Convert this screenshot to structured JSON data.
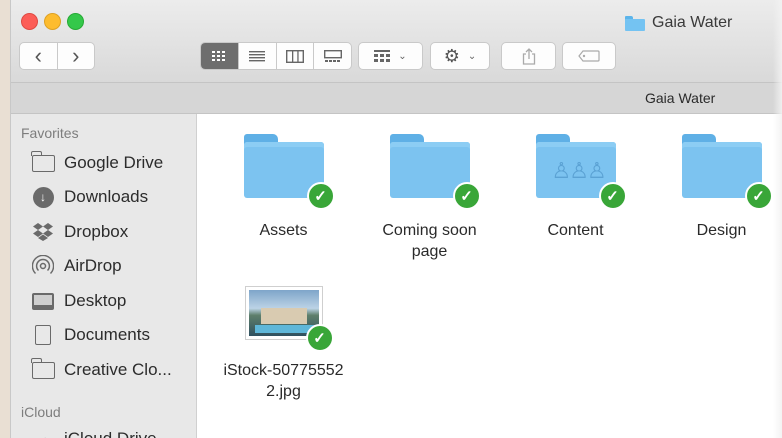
{
  "window": {
    "title": "Gaia Water"
  },
  "toolbar": {
    "back_icon": "chevron-left",
    "forward_icon": "chevron-right",
    "view_modes": [
      "icon-view",
      "list-view",
      "column-view",
      "gallery-view"
    ],
    "active_view": "icon-view",
    "arrange_icon": "group-icon",
    "action_icon": "gear-icon",
    "share_icon": "share-icon",
    "tags_icon": "tag-icon"
  },
  "pathbar": {
    "current": "Gaia Water"
  },
  "sidebar": {
    "favorites_label": "Favorites",
    "icloud_label": "iCloud",
    "items": [
      {
        "label": "Google Drive",
        "icon": "folder-icon"
      },
      {
        "label": "Downloads",
        "icon": "download-icon"
      },
      {
        "label": "Dropbox",
        "icon": "dropbox-icon"
      },
      {
        "label": "AirDrop",
        "icon": "airdrop-icon"
      },
      {
        "label": "Desktop",
        "icon": "desktop-icon"
      },
      {
        "label": "Documents",
        "icon": "documents-icon"
      },
      {
        "label": "Creative Clo...",
        "icon": "folder-icon"
      }
    ],
    "icloud_items": [
      {
        "label": "iCloud Drive",
        "icon": "cloud-icon"
      }
    ]
  },
  "files": [
    {
      "name": "Assets",
      "type": "folder",
      "synced": true
    },
    {
      "name": "Coming soon page",
      "type": "folder",
      "synced": true
    },
    {
      "name": "Content",
      "type": "shared-folder",
      "synced": true
    },
    {
      "name": "Design",
      "type": "folder",
      "synced": true
    },
    {
      "name": "iStock-507755522.jpg",
      "type": "image",
      "synced": true
    }
  ],
  "colors": {
    "folder": "#7cc3f0",
    "sync_badge": "#39a638"
  }
}
